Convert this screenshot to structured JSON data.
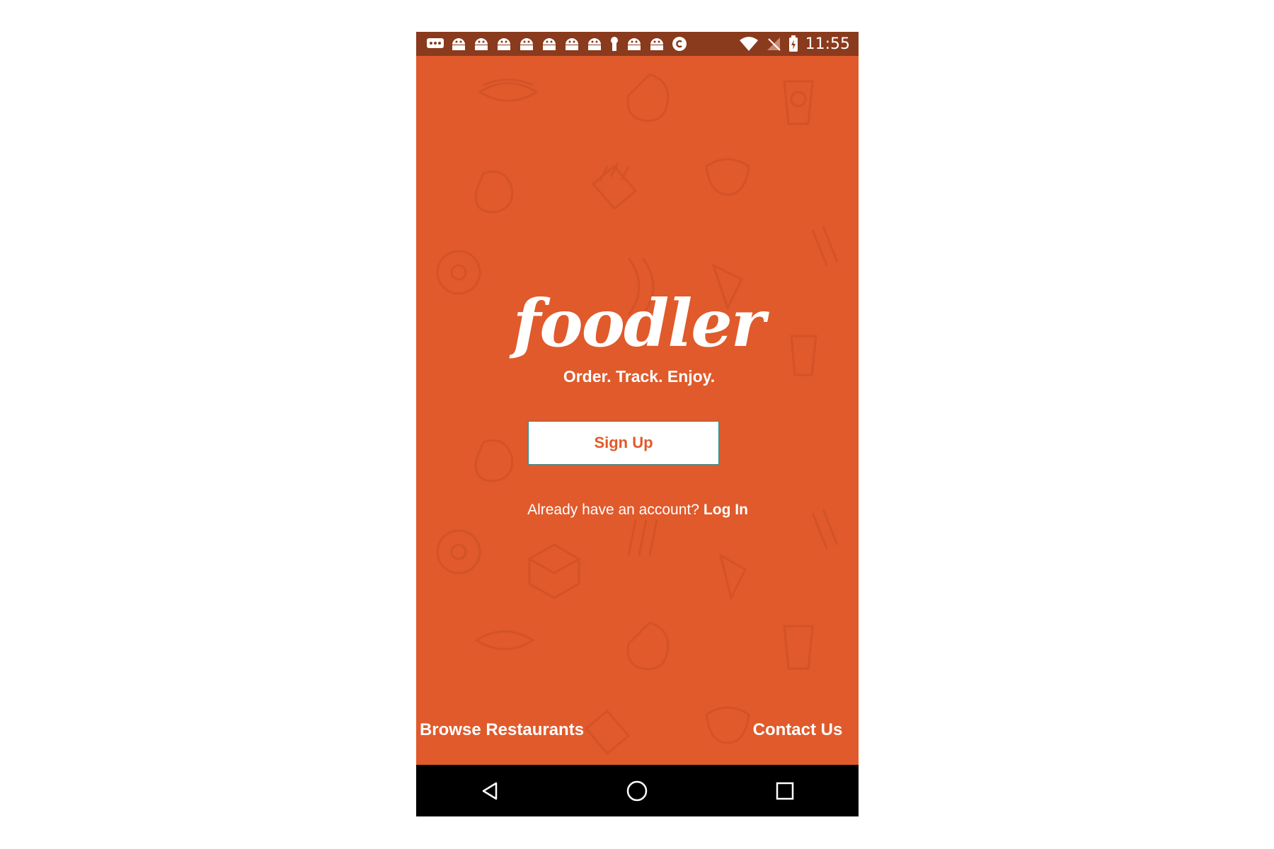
{
  "statusbar": {
    "time": "11:55"
  },
  "brand": {
    "logo_text": "foodler",
    "tagline": "Order. Track. Enjoy."
  },
  "auth": {
    "signup_label": "Sign Up",
    "login_prompt": "Already have an account?",
    "login_label": "Log In"
  },
  "footer": {
    "browse_label": "Browse Restaurants",
    "contact_label": "Contact Us"
  },
  "colors": {
    "background": "#e05a2b",
    "statusbar": "#8a3a1d",
    "navbar": "#000000",
    "button_bg": "#ffffff",
    "button_text": "#e05a2b"
  },
  "icons": {
    "statusbar": [
      "message-icon",
      "android-icon",
      "android-icon",
      "android-icon",
      "android-icon",
      "android-icon",
      "android-icon",
      "android-icon",
      "keyhole-icon",
      "android-icon",
      "android-icon",
      "copyright-icon",
      "wifi-icon",
      "no-signal-icon",
      "battery-charging-icon"
    ],
    "navbar": [
      "back-icon",
      "home-icon",
      "recents-icon"
    ]
  }
}
